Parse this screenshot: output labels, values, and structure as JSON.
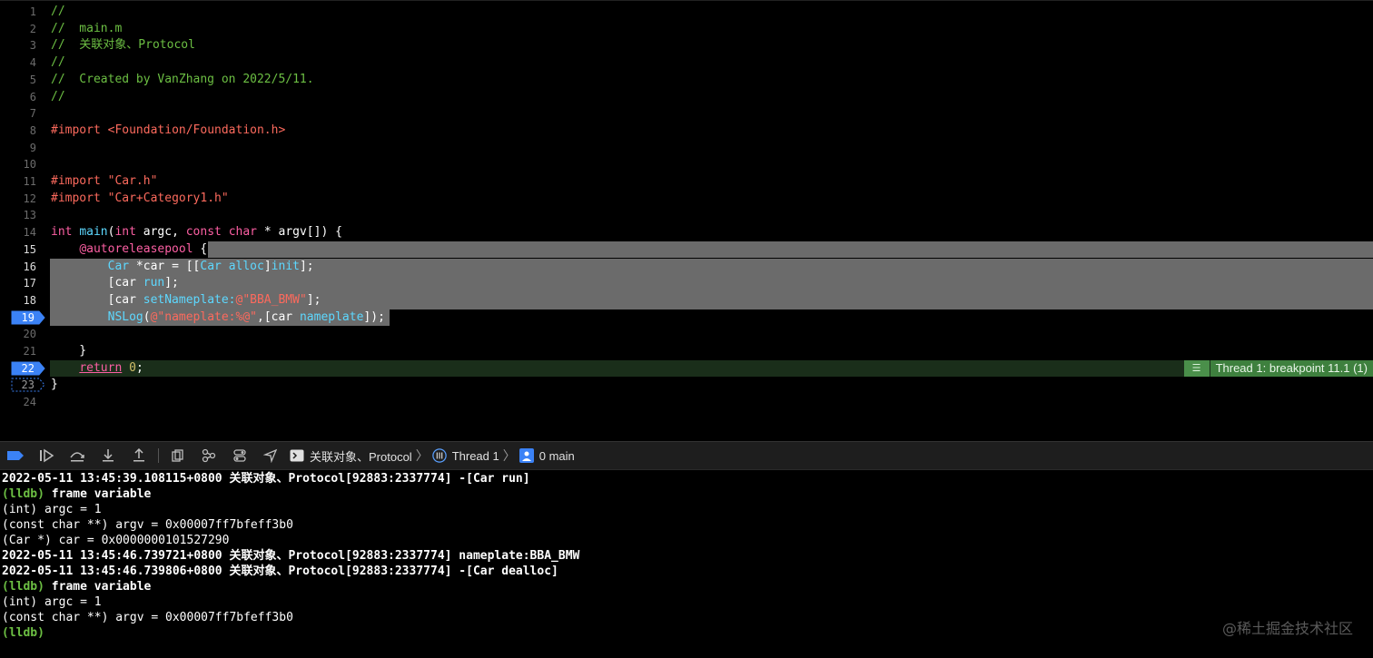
{
  "editor": {
    "lines": [
      {
        "n": "1",
        "segs": [
          {
            "t": "//",
            "c": "c-comment"
          }
        ]
      },
      {
        "n": "2",
        "segs": [
          {
            "t": "//  main.m",
            "c": "c-comment"
          }
        ]
      },
      {
        "n": "3",
        "segs": [
          {
            "t": "//  关联对象、Protocol",
            "c": "c-comment"
          }
        ]
      },
      {
        "n": "4",
        "segs": [
          {
            "t": "//",
            "c": "c-comment"
          }
        ]
      },
      {
        "n": "5",
        "segs": [
          {
            "t": "//  Created by VanZhang on 2022/5/11.",
            "c": "c-comment"
          }
        ]
      },
      {
        "n": "6",
        "segs": [
          {
            "t": "//",
            "c": "c-comment"
          }
        ]
      },
      {
        "n": "7",
        "segs": []
      },
      {
        "n": "8",
        "segs": [
          {
            "t": "#import ",
            "c": "c-str"
          },
          {
            "t": "<Foundation/Foundation.h>",
            "c": "c-str"
          }
        ]
      },
      {
        "n": "9",
        "segs": []
      },
      {
        "n": "10",
        "segs": []
      },
      {
        "n": "11",
        "segs": [
          {
            "t": "#import ",
            "c": "c-str"
          },
          {
            "t": "\"Car.h\"",
            "c": "c-str"
          }
        ]
      },
      {
        "n": "12",
        "segs": [
          {
            "t": "#import ",
            "c": "c-str"
          },
          {
            "t": "\"Car+Category1.h\"",
            "c": "c-str"
          }
        ]
      },
      {
        "n": "13",
        "segs": []
      },
      {
        "n": "14",
        "segs": [
          {
            "t": "int",
            "c": "c-kw"
          },
          {
            "t": " "
          },
          {
            "t": "main",
            "c": "c-type"
          },
          {
            "t": "("
          },
          {
            "t": "int",
            "c": "c-kw"
          },
          {
            "t": " argc, "
          },
          {
            "t": "const",
            "c": "c-kw"
          },
          {
            "t": " "
          },
          {
            "t": "char",
            "c": "c-kw"
          },
          {
            "t": " * argv[]) {"
          }
        ]
      },
      {
        "n": "15",
        "segs": [
          {
            "t": "    "
          },
          {
            "t": "@autoreleasepool",
            "c": "c-kw"
          },
          {
            "t": " {"
          }
        ]
      },
      {
        "n": "16",
        "segs": [
          {
            "t": "        "
          },
          {
            "t": "Car",
            "c": "c-type"
          },
          {
            "t": " *car = [["
          },
          {
            "t": "Car",
            "c": "c-type"
          },
          {
            "t": " "
          },
          {
            "t": "alloc",
            "c": "c-type"
          },
          {
            "t": "]"
          },
          {
            "t": "init",
            "c": "c-type"
          },
          {
            "t": "];"
          }
        ]
      },
      {
        "n": "17",
        "segs": [
          {
            "t": "        [car "
          },
          {
            "t": "run",
            "c": "c-type"
          },
          {
            "t": "];"
          }
        ]
      },
      {
        "n": "18",
        "segs": [
          {
            "t": "        [car "
          },
          {
            "t": "setNameplate:",
            "c": "c-type"
          },
          {
            "t": "@\"BBA_BMW\"",
            "c": "c-str"
          },
          {
            "t": "];"
          }
        ]
      },
      {
        "n": "19",
        "segs": [
          {
            "t": "        "
          },
          {
            "t": "NSLog",
            "c": "c-type"
          },
          {
            "t": "("
          },
          {
            "t": "@\"nameplate:%@\"",
            "c": "c-str"
          },
          {
            "t": ",[car "
          },
          {
            "t": "nameplate",
            "c": "c-type"
          },
          {
            "t": "]);"
          }
        ]
      },
      {
        "n": "20",
        "segs": []
      },
      {
        "n": "21",
        "segs": [
          {
            "t": "    }"
          }
        ]
      },
      {
        "n": "22",
        "segs": [
          {
            "t": "    "
          },
          {
            "t": "return",
            "c": "c-kw"
          },
          {
            "t": " "
          },
          {
            "t": "0",
            "c": "c-num"
          },
          {
            "t": ";"
          }
        ]
      },
      {
        "n": "23",
        "segs": [
          {
            "t": "}"
          }
        ]
      },
      {
        "n": "24",
        "segs": []
      }
    ],
    "thread_badge": "Thread 1: breakpoint 11.1 (1)"
  },
  "toolbar": {
    "buttons": [
      "breakpoints-toggle-icon",
      "continue-icon",
      "step-over-icon",
      "step-into-icon",
      "step-out-icon",
      "debug-view-hierarchy-icon",
      "memory-graph-icon",
      "environment-overrides-icon",
      "simulate-location-icon"
    ],
    "crumbs": {
      "target": "关联对象、Protocol",
      "thread": "Thread 1",
      "frame": "0 main"
    }
  },
  "console": {
    "lines": [
      {
        "t": "2022-05-11 13:45:39.108115+0800 关联对象、Protocol[92883:2337774] -[Car run]",
        "bold": true
      },
      {
        "prompt": "(lldb)",
        "t": " frame variable",
        "bold": true
      },
      {
        "t": "(int) argc = 1",
        "bold": false
      },
      {
        "t": "(const char **) argv = 0x00007ff7bfeff3b0",
        "bold": false
      },
      {
        "t": "(Car *) car = 0x0000000101527290",
        "bold": false
      },
      {
        "t": "2022-05-11 13:45:46.739721+0800 关联对象、Protocol[92883:2337774] nameplate:BBA_BMW",
        "bold": true
      },
      {
        "t": "2022-05-11 13:45:46.739806+0800 关联对象、Protocol[92883:2337774] -[Car dealloc]",
        "bold": true
      },
      {
        "prompt": "(lldb)",
        "t": " frame variable",
        "bold": true
      },
      {
        "t": "(int) argc = 1",
        "bold": false
      },
      {
        "t": "(const char **) argv = 0x00007ff7bfeff3b0",
        "bold": false
      },
      {
        "prompt": "(lldb)",
        "t": "",
        "bold": true
      }
    ]
  },
  "watermark": "@稀土掘金技术社区",
  "colors": {
    "breakpoint": "#3b82f6",
    "pc_line": "#1a2e1a",
    "badge": "#3e803e"
  }
}
